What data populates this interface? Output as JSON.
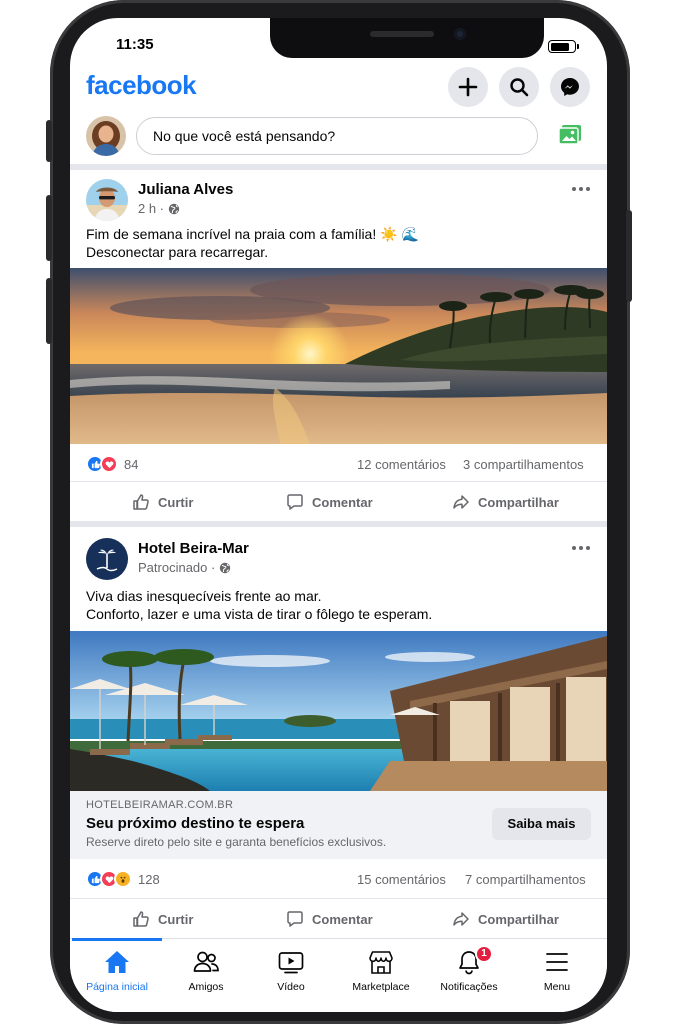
{
  "status": {
    "time": "11:35"
  },
  "header": {
    "logo": "facebook"
  },
  "composer": {
    "placeholder": "No que você está pensando?"
  },
  "posts": [
    {
      "author": "Juliana Alves",
      "meta": "2 h ·",
      "text_line1": "Fim de semana incrível na praia com a família! ☀️ 🌊",
      "text_line2": "Desconectar para recarregar.",
      "reaction_count": "84",
      "comments": "12 comentários",
      "shares": "3 compartilhamentos"
    },
    {
      "author": "Hotel Beira-Mar",
      "meta": "Patrocinado ·",
      "text_line1": "Viva dias inesquecíveis frente ao mar.",
      "text_line2": "Conforto, lazer e uma vista de tirar o fôlego te esperam.",
      "ad_domain": "HOTELBEIRAMAR.COM.BR",
      "ad_title": "Seu próximo destino te espera",
      "ad_desc": "Reserve direto pelo site e garanta benefícios exclusivos.",
      "ad_cta": "Saiba mais",
      "reaction_count": "128",
      "comments": "15 comentários",
      "shares": "7 compartilhamentos"
    }
  ],
  "actions": {
    "like": "Curtir",
    "comment": "Comentar",
    "share": "Compartilhar"
  },
  "nav": {
    "home": "Página inicial",
    "friends": "Amigos",
    "video": "Vídeo",
    "marketplace": "Marketplace",
    "notifications": "Notificações",
    "notifications_badge": "1",
    "menu": "Menu"
  },
  "colors": {
    "brand": "#1877F2",
    "badge": "#E41E3F",
    "love": "#F33E58",
    "wow": "#F7B125"
  }
}
